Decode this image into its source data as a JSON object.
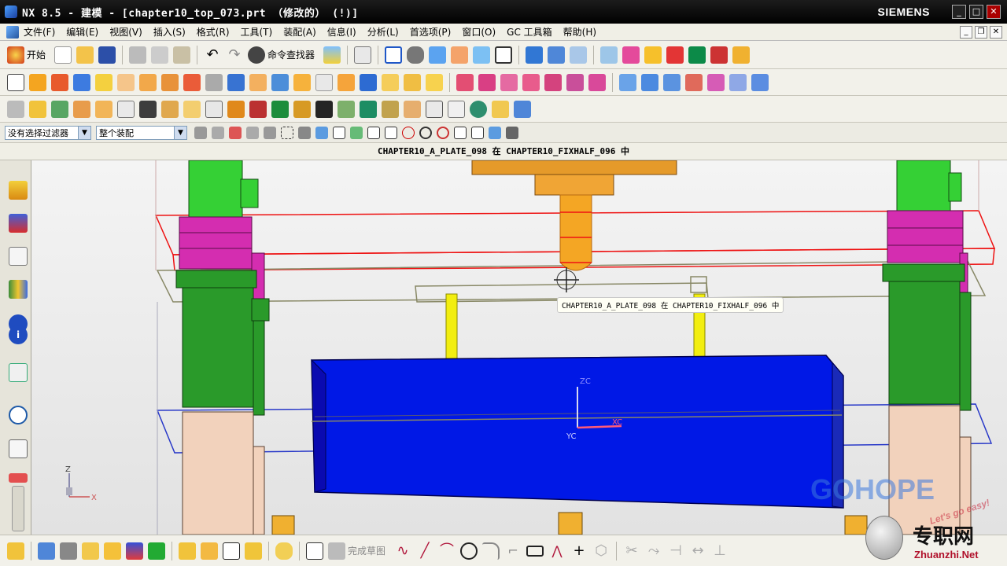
{
  "window": {
    "title": "NX 8.5 - 建模 - [chapter10_top_073.prt  （修改的）    (!)]",
    "brand": "SIEMENS",
    "controls": [
      "_",
      "□",
      "✕"
    ]
  },
  "menu": {
    "items": [
      "文件(F)",
      "编辑(E)",
      "视图(V)",
      "插入(S)",
      "格式(R)",
      "工具(T)",
      "装配(A)",
      "信息(I)",
      "分析(L)",
      "首选项(P)",
      "窗口(O)",
      "GC 工具箱",
      "帮助(H)"
    ],
    "doc_controls": [
      "_",
      "❐",
      "✕"
    ]
  },
  "toolbar": {
    "start_label": "开始",
    "command_finder_label": "命令查找器"
  },
  "selection": {
    "filter_value": "没有选择过滤器",
    "scope_value": "整个装配"
  },
  "status": {
    "work_part": "CHAPTER10_A_PLATE_098 在 CHAPTER10_FIXHALF_096 中"
  },
  "viewport": {
    "tooltip": "CHAPTER10_A_PLATE_098 在 CHAPTER10_FIXHALF_096 中",
    "axis_zc": "ZC",
    "axis_yc": "YC",
    "axis_xc": "XC",
    "triad_z": "Z",
    "triad_x": "X"
  },
  "bottom_toolbar": {
    "finish_sketch_label": "完成草图"
  },
  "watermark": {
    "gohope": "GOHOPE",
    "cn": "专职网",
    "url": "Zhuanzhi.Net",
    "tagline": "Let's go easy!"
  },
  "colors": {
    "accent_blue": "#0018e6",
    "green": "#33c033",
    "magenta": "#d42db0",
    "orange": "#f0a020",
    "yellow": "#f5f000",
    "beige": "#f2d2bc"
  }
}
